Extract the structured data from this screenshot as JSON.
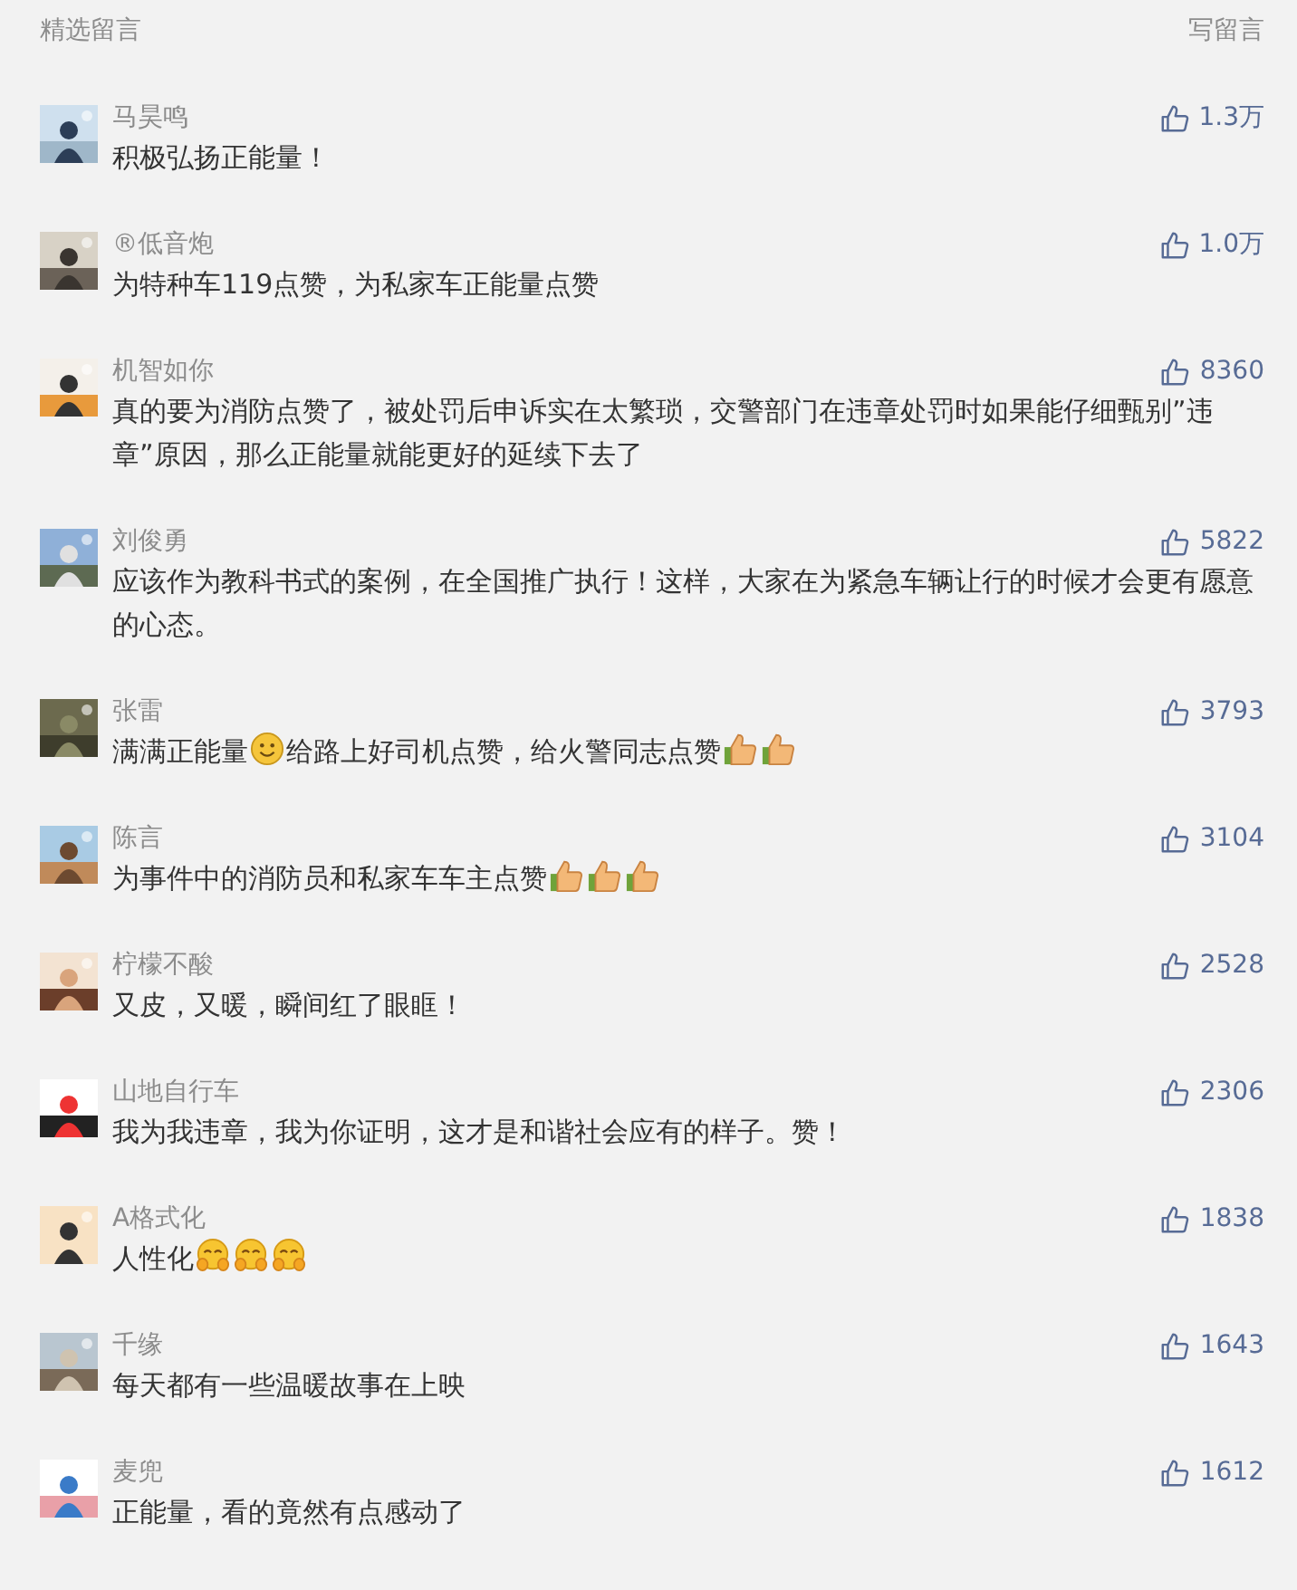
{
  "header": {
    "title": "精选留言",
    "write_link": "写留言"
  },
  "comments": [
    {
      "name": "马昊鸣",
      "likes": "1.3万",
      "parts": [
        {
          "kind": "text",
          "text": "积极弘扬正能量！"
        }
      ]
    },
    {
      "name": "®低音炮",
      "likes": "1.0万",
      "parts": [
        {
          "kind": "text",
          "text": "为特种车119点赞，为私家车正能量点赞"
        }
      ]
    },
    {
      "name": "机智如你",
      "likes": "8360",
      "parts": [
        {
          "kind": "text",
          "text": "真的要为消防点赞了，被处罚后申诉实在太繁琐，交警部门在违章处罚时如果能仔细甄别”违章”原因，那么正能量就能更好的延续下去了"
        }
      ]
    },
    {
      "name": "刘俊勇",
      "likes": "5822",
      "parts": [
        {
          "kind": "text",
          "text": "应该作为教科书式的案例，在全国推广执行！这样，大家在为紧急车辆让行的时候才会更有愿意的心态。"
        }
      ]
    },
    {
      "name": "张雷",
      "likes": "3793",
      "parts": [
        {
          "kind": "text",
          "text": "满满正能量"
        },
        {
          "kind": "smile"
        },
        {
          "kind": "text",
          "text": "给路上好司机点赞，给火警同志点赞"
        },
        {
          "kind": "thumb"
        },
        {
          "kind": "thumb"
        }
      ]
    },
    {
      "name": "陈言",
      "likes": "3104",
      "parts": [
        {
          "kind": "text",
          "text": "为事件中的消防员和私家车车主点赞"
        },
        {
          "kind": "thumb"
        },
        {
          "kind": "thumb"
        },
        {
          "kind": "thumb"
        }
      ]
    },
    {
      "name": "柠檬不酸",
      "likes": "2528",
      "parts": [
        {
          "kind": "text",
          "text": "又皮，又暖，瞬间红了眼眶！"
        }
      ]
    },
    {
      "name": "山地自行车",
      "likes": "2306",
      "parts": [
        {
          "kind": "text",
          "text": "我为我违章，我为你证明，这才是和谐社会应有的样子。赞！"
        }
      ]
    },
    {
      "name": "A格式化",
      "likes": "1838",
      "parts": [
        {
          "kind": "text",
          "text": "人性化"
        },
        {
          "kind": "hug"
        },
        {
          "kind": "hug"
        },
        {
          "kind": "hug"
        }
      ]
    },
    {
      "name": "千缘",
      "likes": "1643",
      "parts": [
        {
          "kind": "text",
          "text": "每天都有一些温暖故事在上映"
        }
      ]
    },
    {
      "name": "麦兜",
      "likes": "1612",
      "parts": [
        {
          "kind": "text",
          "text": "正能量，看的竟然有点感动了"
        }
      ]
    }
  ]
}
